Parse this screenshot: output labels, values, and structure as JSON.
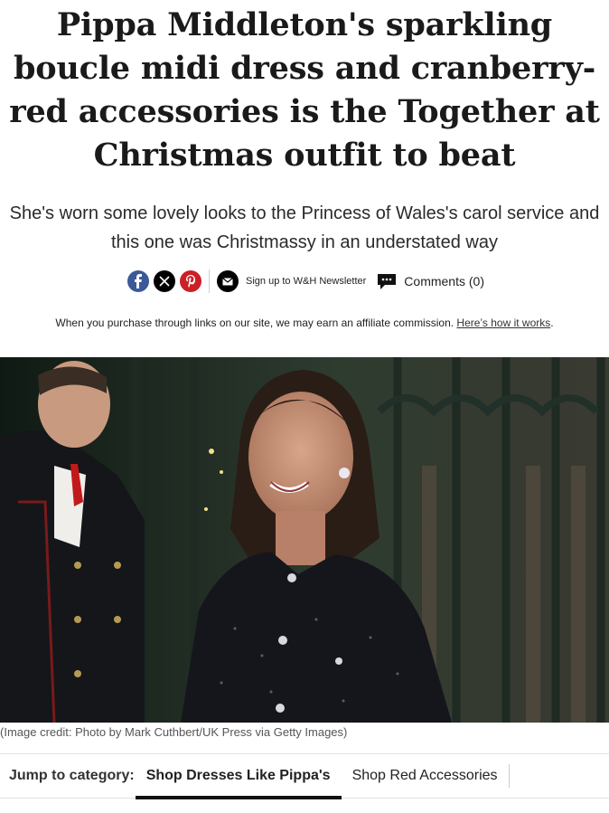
{
  "article": {
    "headline": "Pippa Middleton's sparkling boucle midi dress and cranberry-red accessories is the Together at Christmas outfit to beat",
    "standfirst": "She's worn some lovely looks to the Princess of Wales's carol service and this one was Christmassy in an understated way"
  },
  "share": {
    "icons": [
      "facebook-icon",
      "x-icon",
      "pinterest-icon"
    ],
    "newsletter_label": "Sign up to W&H Newsletter",
    "comments_label": "Comments (0)"
  },
  "affiliate": {
    "text": "When you purchase through links on our site, we may earn an affiliate commission.",
    "link_text": "Here’s how it works",
    "suffix": "."
  },
  "image": {
    "caption": "(Image credit: Photo by Mark Cuthbert/UK Press via Getty Images)"
  },
  "jump": {
    "label": "Jump to category:",
    "tabs": [
      "Shop Dresses Like Pippa's",
      "Shop Red Accessories"
    ]
  },
  "colors": {
    "facebook": "#3b5998",
    "x": "#000000",
    "pinterest": "#cb2027"
  }
}
